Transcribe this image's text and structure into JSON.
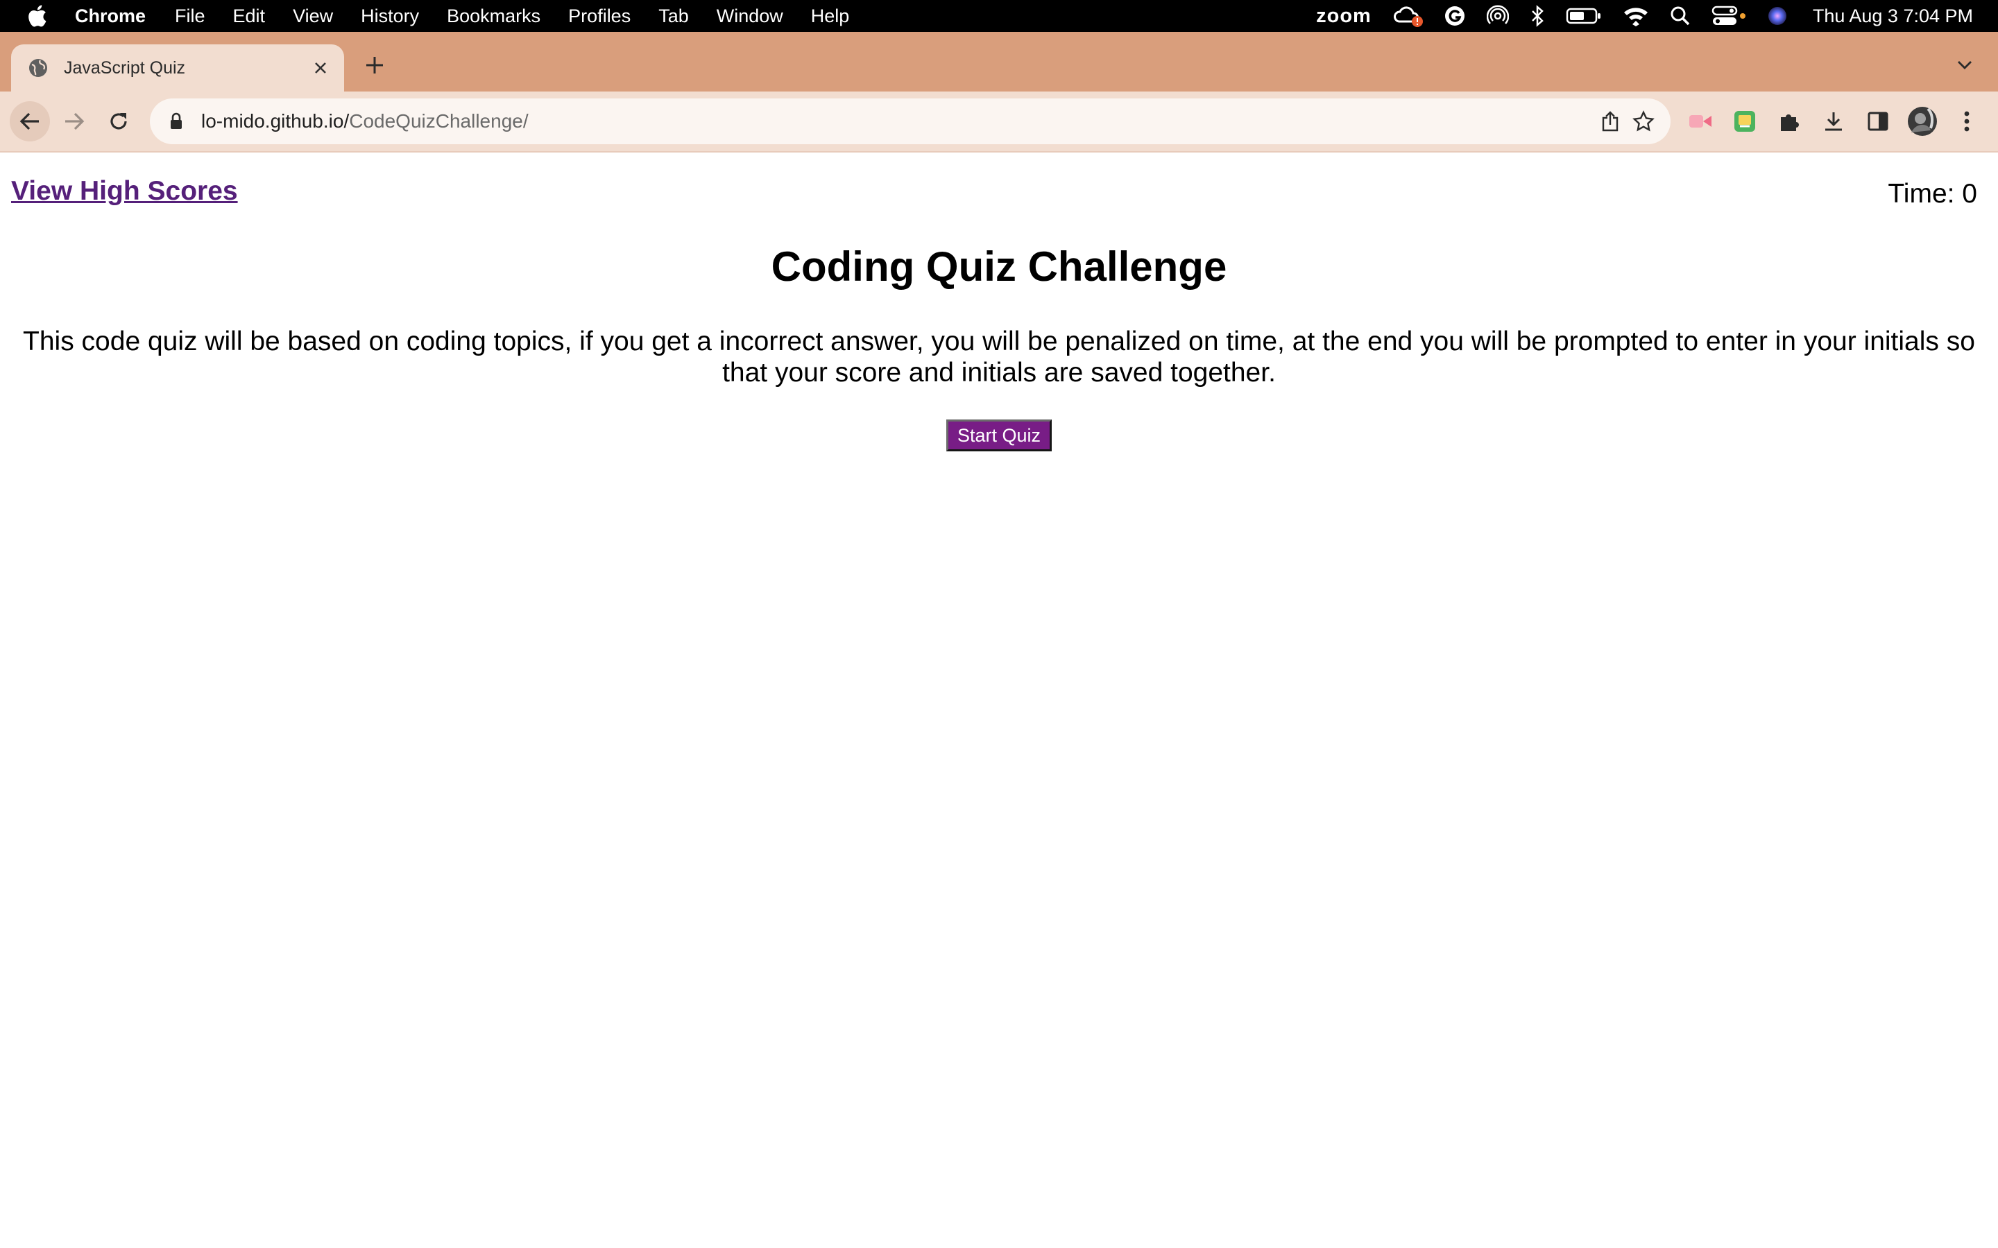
{
  "menubar": {
    "items": [
      "Chrome",
      "File",
      "Edit",
      "View",
      "History",
      "Bookmarks",
      "Profiles",
      "Tab",
      "Window",
      "Help"
    ],
    "status": {
      "zoom": "zoom",
      "clock": "Thu Aug 3  7:04 PM"
    }
  },
  "tabs": [
    {
      "title": "JavaScript Quiz",
      "active": true
    }
  ],
  "address": {
    "domain": "lo-mido.github.io/",
    "path": "CodeQuizChallenge/"
  },
  "page": {
    "high_scores_link": "View High Scores",
    "timer": "Time: 0",
    "title": "Coding Quiz Challenge",
    "description": "This code quiz will be based on coding topics, if you get a incorrect answer, you will be penalized on time, at the end you will be prompted to enter in your initials so that your score and initials are saved together.",
    "start_button": "Start Quiz"
  },
  "colors": {
    "tab_strip": "#d99e7c",
    "toolbar": "#f2ddd0",
    "link": "#55207a",
    "start_button": "#781d86"
  }
}
